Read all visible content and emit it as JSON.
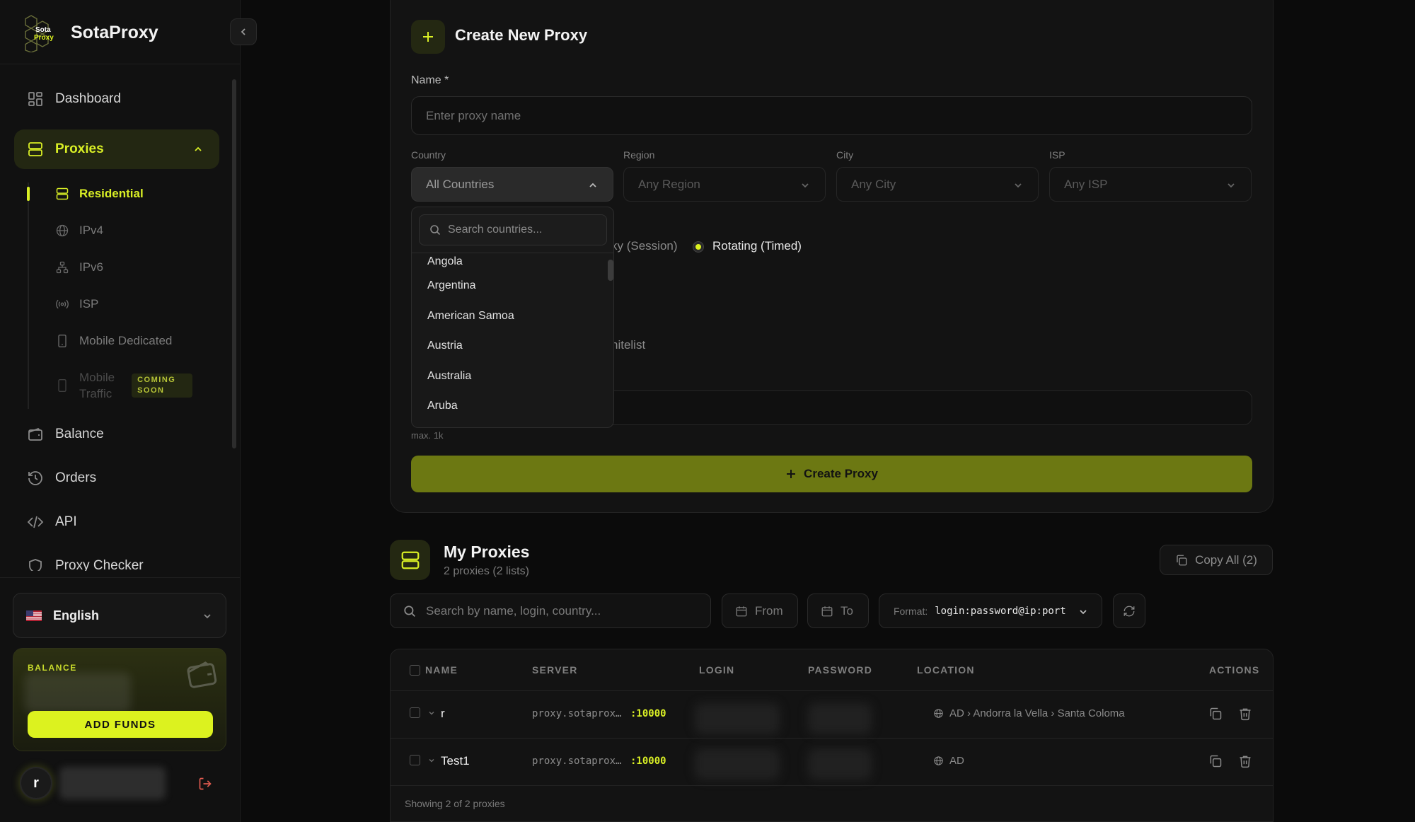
{
  "brand": {
    "name": "SotaProxy",
    "logo_text_1": "Sota",
    "logo_text_2": "Proxy"
  },
  "colors": {
    "accent": "#dcf21f",
    "accent_dim": "#6c7812",
    "bg": "#0b0b0b",
    "panel": "#131313"
  },
  "nav": {
    "dashboard": "Dashboard",
    "proxies": "Proxies",
    "sub": {
      "residential": "Residential",
      "ipv4": "IPv4",
      "ipv6": "IPv6",
      "isp": "ISP",
      "mobile_dedicated": "Mobile Dedicated",
      "mobile_traffic_1": "Mobile",
      "mobile_traffic_2": "Traffic",
      "coming_soon_1": "COMING",
      "coming_soon_2": "SOON"
    },
    "balance": "Balance",
    "orders": "Orders",
    "api": "API",
    "proxy_checker": "Proxy Checker"
  },
  "language": {
    "selected": "English"
  },
  "balance_card": {
    "label": "BALANCE",
    "add_funds": "ADD FUNDS"
  },
  "user": {
    "initial": "r"
  },
  "create": {
    "title": "Create New Proxy",
    "name_label": "Name *",
    "name_placeholder": "Enter proxy name",
    "country_label": "Country",
    "region_label": "Region",
    "city_label": "City",
    "isp_label": "ISP",
    "country_value": "All Countries",
    "region_value": "Any Region",
    "city_value": "Any City",
    "isp_value": "Any ISP",
    "sticky_partial": "ky (Session)",
    "rotating": "Rotating (Timed)",
    "whitelist_partial": "hitelist",
    "max_hint": "max. 1k",
    "create_button": "Create Proxy"
  },
  "country_dropdown": {
    "search_placeholder": "Search countries...",
    "items": [
      "Angola",
      "Argentina",
      "American Samoa",
      "Austria",
      "Australia",
      "Aruba"
    ]
  },
  "my_proxies": {
    "title": "My Proxies",
    "subtitle": "2 proxies (2 lists)",
    "copy_all": "Copy All (2)",
    "search_placeholder": "Search by name, login, country...",
    "from": "From",
    "to": "To",
    "format_label": "Format:",
    "format_value": "login:password@ip:port",
    "columns": {
      "name": "NAME",
      "server": "SERVER",
      "login": "LOGIN",
      "password": "PASSWORD",
      "location": "LOCATION",
      "actions": "ACTIONS"
    },
    "rows": [
      {
        "name": "r",
        "server": "proxy.sotaprox…",
        "port": ":10000",
        "location": "AD › Andorra la Vella › Santa Coloma"
      },
      {
        "name": "Test1",
        "server": "proxy.sotaprox…",
        "port": ":10000",
        "location": "AD"
      }
    ],
    "footer": "Showing 2 of 2 proxies"
  }
}
